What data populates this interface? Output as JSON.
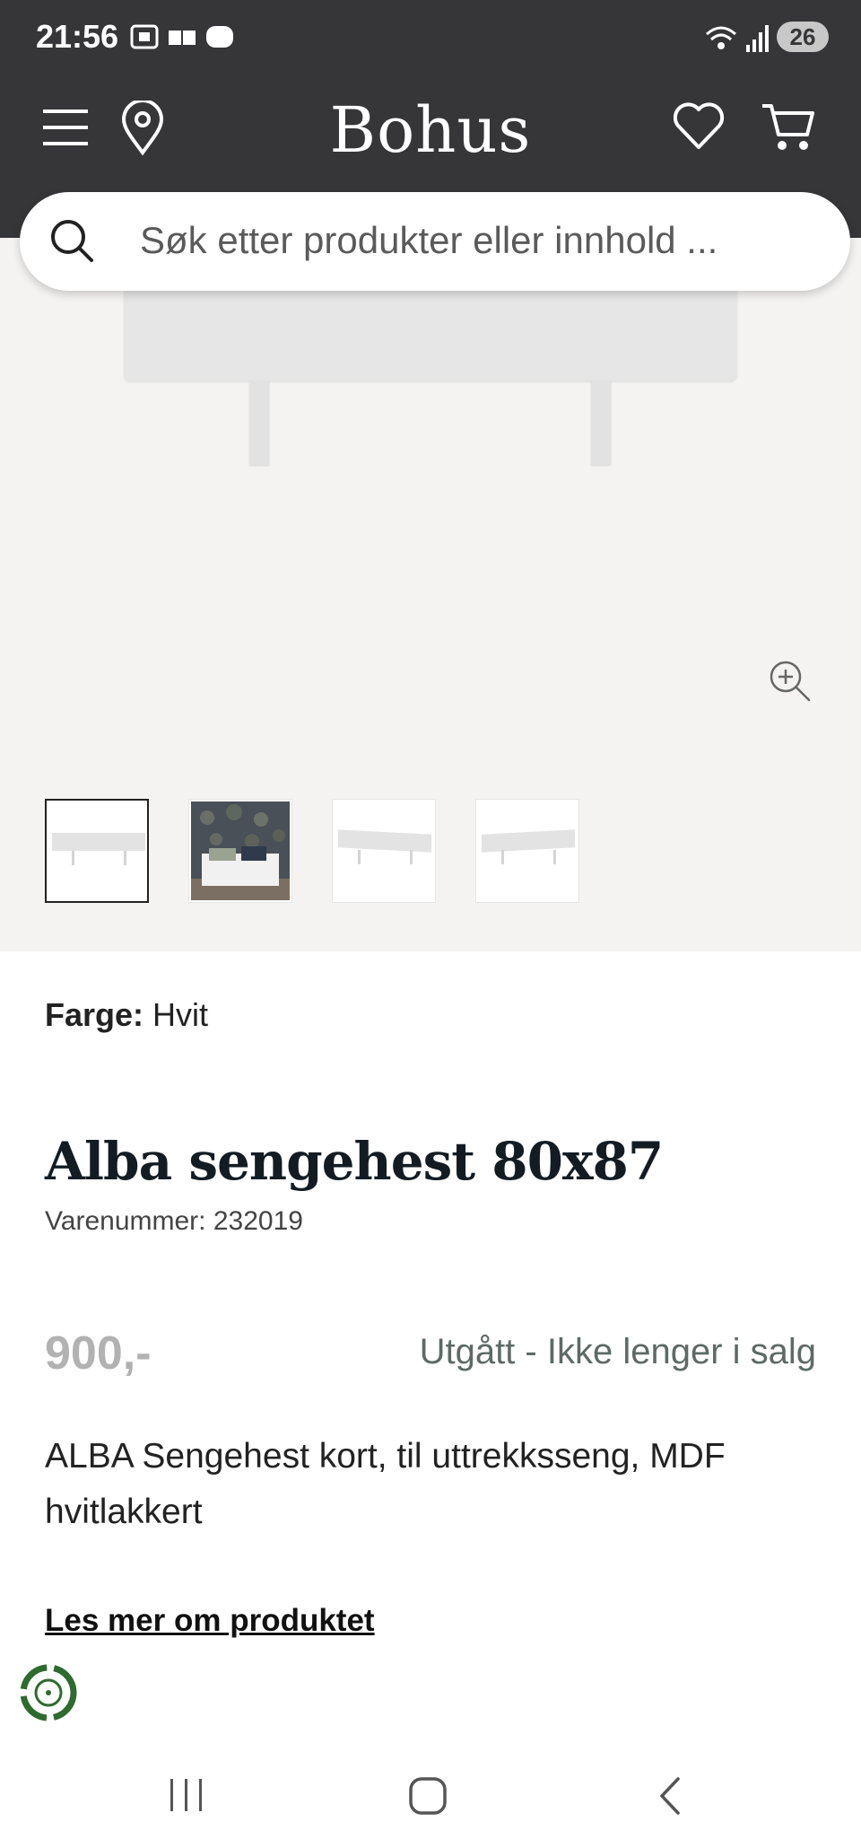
{
  "status_bar": {
    "time": "21:56",
    "battery": "26",
    "icons": [
      "screenshot-icon",
      "cast-icon",
      "wear-icon",
      "wifi-icon",
      "signal-icon"
    ]
  },
  "header": {
    "brand": "Bohus",
    "icons": [
      "menu-icon",
      "location-icon",
      "heart-icon",
      "cart-icon"
    ]
  },
  "search": {
    "placeholder": "Søk etter produkter eller innhold ..."
  },
  "gallery": {
    "thumbnail_count": 4,
    "selected_index": 0
  },
  "product": {
    "color_label": "Farge:",
    "color_value": "Hvit",
    "title": "Alba sengehest 80x87",
    "sku": "Varenummer: 232019",
    "price": "900,-",
    "availability": "Utgått - Ikke lenger i salg",
    "description": "ALBA Sengehest kort, til uttrekksseng, MDF hvitlakkert",
    "read_more": "Les mer om produktet"
  },
  "colors": {
    "header_bg": "#363639",
    "image_bg": "#f4f3f2",
    "price": "#b2b2b2",
    "availability": "#5d6a66",
    "eco_green": "#2e6b2e"
  }
}
